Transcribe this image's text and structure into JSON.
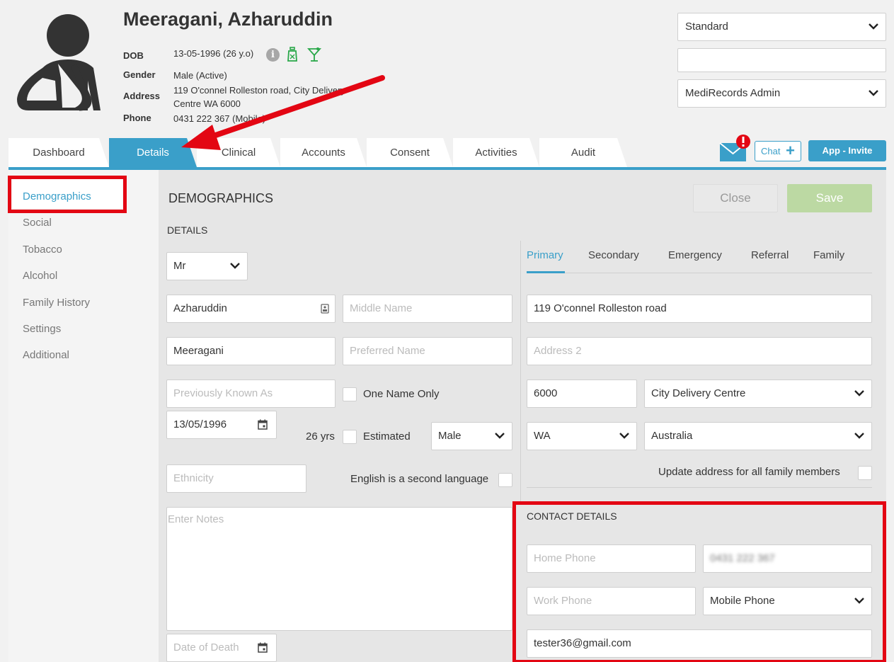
{
  "patient": {
    "name": "Meeragani, Azharuddin",
    "dob_label": "DOB",
    "dob": "13-05-1996 (26 y.o)",
    "gender_label": "Gender",
    "gender": "Male (Active)",
    "address_label": "Address",
    "address_line1": "119 O'connel Rolleston road, City Delivery",
    "address_line2": "Centre WA 6000",
    "phone_label": "Phone",
    "phone": "0431 222 367 (Mobile)"
  },
  "header_selects": {
    "template": "Standard",
    "blank": "",
    "user": "MediRecords Admin"
  },
  "tabs": [
    {
      "label": "Dashboard"
    },
    {
      "label": "Details"
    },
    {
      "label": "Clinical"
    },
    {
      "label": "Accounts"
    },
    {
      "label": "Consent"
    },
    {
      "label": "Activities"
    },
    {
      "label": "Audit"
    }
  ],
  "actions": {
    "chat": "Chat",
    "invite": "App - Invite"
  },
  "sidebar": {
    "items": [
      {
        "label": "Demographics"
      },
      {
        "label": "Social"
      },
      {
        "label": "Tobacco"
      },
      {
        "label": "Alcohol"
      },
      {
        "label": "Family History"
      },
      {
        "label": "Settings"
      },
      {
        "label": "Additional"
      }
    ]
  },
  "form": {
    "section_title": "DEMOGRAPHICS",
    "details_title": "DETAILS",
    "close": "Close",
    "save": "Save",
    "title_value": "Mr",
    "first_name": "Azharuddin",
    "middle_name_ph": "Middle Name",
    "last_name": "Meeragani",
    "preferred_name_ph": "Preferred Name",
    "previously_known_ph": "Previously Known As",
    "one_name_only": "One Name Only",
    "dob_value": "13/05/1996",
    "age": "26 yrs",
    "estimated": "Estimated",
    "gender_value": "Male",
    "ethnicity_ph": "Ethnicity",
    "esl": "English is a second language",
    "notes_ph": "Enter Notes",
    "date_of_death_ph": "Date of Death"
  },
  "address": {
    "tabs": [
      {
        "label": "Primary"
      },
      {
        "label": "Secondary"
      },
      {
        "label": "Emergency"
      },
      {
        "label": "Referral"
      },
      {
        "label": "Family"
      }
    ],
    "address1": "119 O'connel Rolleston road",
    "address2_ph": "Address 2",
    "postcode": "6000",
    "suburb": "City Delivery Centre",
    "state": "WA",
    "country": "Australia",
    "update_family": "Update address for all family members"
  },
  "contact": {
    "title": "CONTACT DETAILS",
    "home_phone_ph": "Home Phone",
    "mobile_value": "0431 222 367",
    "work_phone_ph": "Work Phone",
    "phone_type": "Mobile Phone",
    "email": "tester36@gmail.com"
  },
  "colors": {
    "accent": "#3a9fc9",
    "annotation_red": "#e30613",
    "save_disabled": "#bcd9a3"
  }
}
